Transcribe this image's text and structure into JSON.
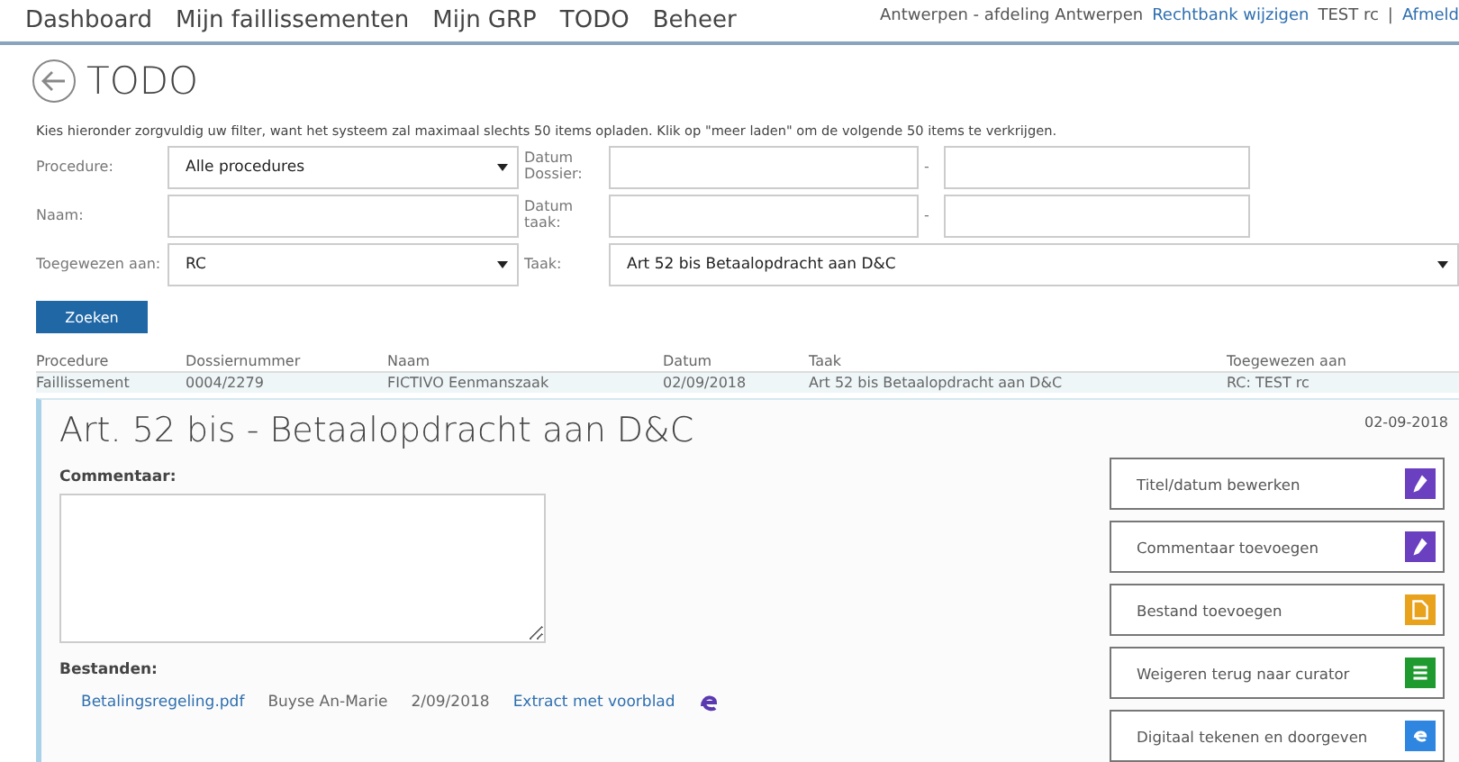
{
  "nav": {
    "items": [
      {
        "label": "Dashboard"
      },
      {
        "label": "Mijn faillissementen"
      },
      {
        "label": "Mijn GRP"
      },
      {
        "label": "TODO"
      },
      {
        "label": "Beheer"
      }
    ],
    "user_info": {
      "court": "Antwerpen - afdeling Antwerpen",
      "change_link": "Rechtbank wijzigen",
      "user": "TEST rc",
      "separator": "|",
      "logout": "Afmeld"
    }
  },
  "page": {
    "title": "TODO"
  },
  "filter": {
    "hint": "Kies hieronder zorgvuldig uw filter, want het systeem zal maximaal slechts 50 items opladen. Klik op \"meer laden\" om de volgende 50 items te verkrijgen.",
    "procedure_label": "Procedure:",
    "procedure_value": "Alle procedures",
    "date_dossier_label": "Datum Dossier:",
    "date_sep_1": "-",
    "name_label": "Naam:",
    "date_task_label": "Datum taak:",
    "date_sep_2": "-",
    "assigned_label": "Toegewezen aan:",
    "assigned_value": "RC",
    "task_label": "Taak:",
    "task_value": "Art 52 bis Betaalopdracht aan D&C",
    "search_button": "Zoeken"
  },
  "table": {
    "columns": [
      "Procedure",
      "Dossiernummer",
      "Naam",
      "Datum",
      "Taak",
      "Toegewezen aan"
    ],
    "rows": [
      {
        "selected": true,
        "cells": [
          "Faillissement",
          "0004/2279",
          "FICTIVO Eenmanszaak",
          "02/09/2018",
          "Art 52 bis Betaalopdracht aan D&C",
          "RC: TEST rc"
        ]
      }
    ]
  },
  "detail": {
    "title": "Art. 52 bis - Betaalopdracht aan D&C",
    "date": "02-09-2018",
    "comment_label": "Commentaar:",
    "files_label": "Bestanden:",
    "files": [
      {
        "name": "Betalingsregeling.pdf",
        "author": "Buyse An-Marie",
        "date": "2/09/2018",
        "action": "Extract met voorblad"
      }
    ],
    "actions": [
      {
        "label": "Titel/datum bewerken",
        "kind": "pencil",
        "color": "#6a3fc0"
      },
      {
        "label": "Commentaar toevoegen",
        "kind": "pencil",
        "color": "#6a3fc0"
      },
      {
        "label": "Bestand toevoegen",
        "kind": "file",
        "color": "#e8a21c"
      },
      {
        "label": "Weigeren terug naar curator",
        "kind": "list",
        "color": "#1e9a2e"
      },
      {
        "label": "Digitaal tekenen en doorgeven",
        "kind": "sign",
        "color": "#2f86e0"
      }
    ]
  }
}
